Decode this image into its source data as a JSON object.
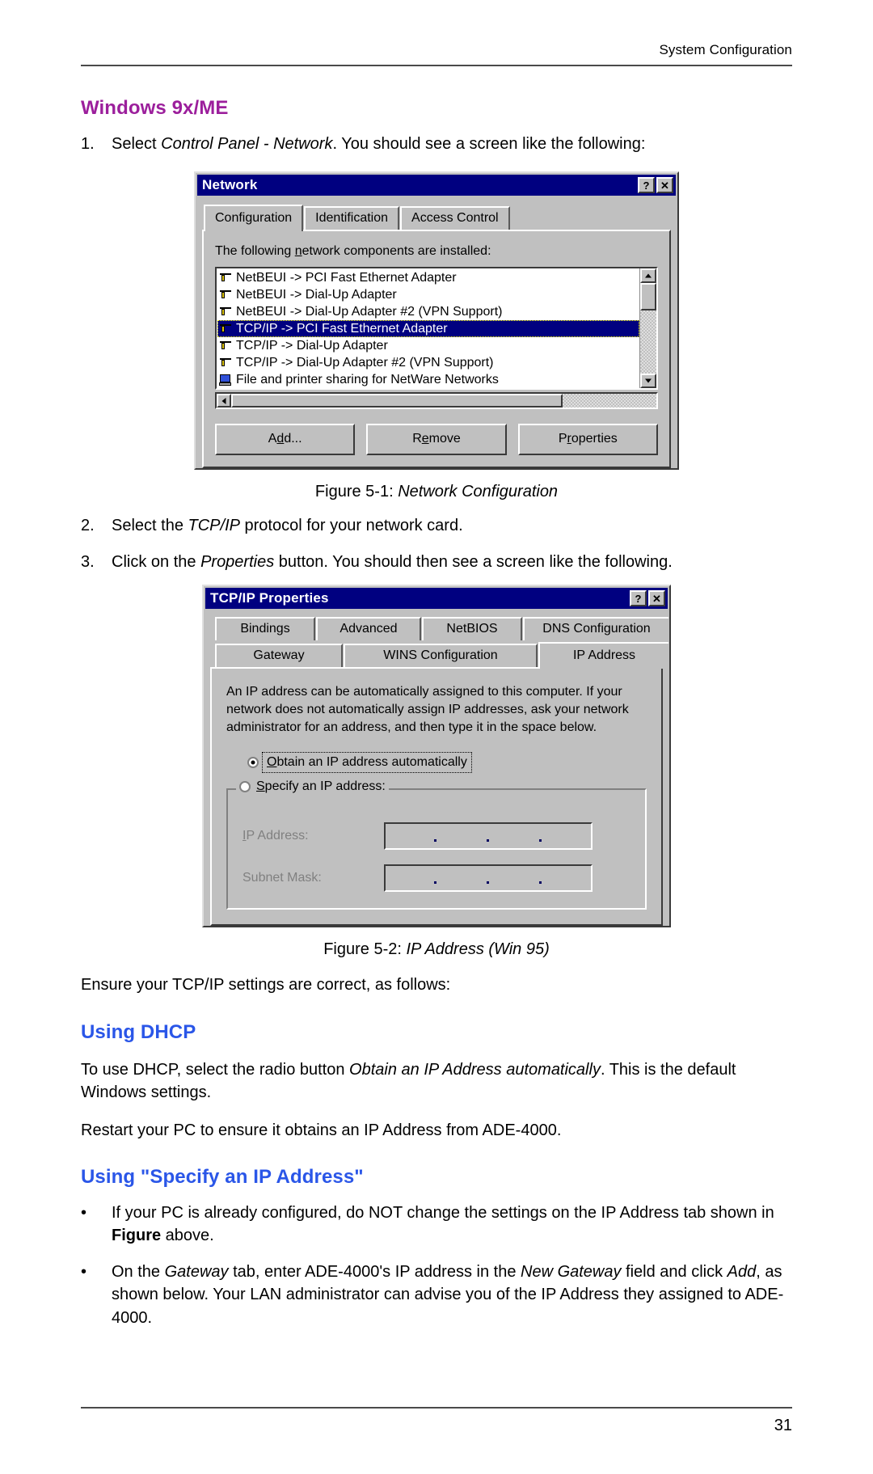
{
  "header": {
    "running_head": "System Configuration"
  },
  "sections": {
    "windows_heading": "Windows 9x/ME",
    "step1_num": "1.",
    "step1_pre": "Select ",
    "step1_italic": "Control Panel - Network",
    "step1_post": ". You should see a screen like the following:",
    "step2_num": "2.",
    "step2_pre": "Select the ",
    "step2_italic": "TCP/IP",
    "step2_post": " protocol for your network card.",
    "step3_num": "3.",
    "step3_pre": "Click on the ",
    "step3_italic": "Properties",
    "step3_post": " button. You should then see a screen like the following.",
    "ensure_line": "Ensure your TCP/IP settings are correct, as follows:",
    "dhcp_heading": "Using DHCP",
    "dhcp_p1_pre": "To use DHCP, select the radio button ",
    "dhcp_p1_italic": "Obtain an IP Address automatically",
    "dhcp_p1_post": ". This is the default Windows settings.",
    "dhcp_p2": "Restart your PC to ensure it obtains an IP Address from ADE-4000.",
    "specify_heading": "Using \"Specify an IP Address\"",
    "bullet_char": "•",
    "bullet1_a": "If your PC is already configured, do NOT change the settings on the IP Address tab shown in ",
    "bullet1_bold": "Figure",
    "bullet1_b": "  above.",
    "bullet2_a": "On the ",
    "bullet2_it1": "Gateway",
    "bullet2_b": " tab, enter ADE-4000's IP address in the ",
    "bullet2_it2": "New Gateway",
    "bullet2_c": " field and click ",
    "bullet2_it3": "Add",
    "bullet2_d": ", as shown below. Your LAN administrator can advise you of the IP Address they assigned to ADE-4000."
  },
  "figure1": {
    "caption_label": "Figure 5-1: ",
    "caption_italic": "Network Configuration",
    "title": "Network",
    "help_btn": "?",
    "close_btn": "✕",
    "tabs": [
      {
        "label": "Configuration",
        "active": true
      },
      {
        "label": "Identification",
        "active": false
      },
      {
        "label": "Access Control",
        "active": false
      }
    ],
    "list_label_pre": "The following ",
    "list_label_underline": "n",
    "list_label_post": "etwork components are installed:",
    "list_items": [
      {
        "text": "NetBEUI -> PCI Fast Ethernet Adapter",
        "icon": "protocol-icon",
        "selected": false
      },
      {
        "text": "NetBEUI -> Dial-Up Adapter",
        "icon": "protocol-icon",
        "selected": false
      },
      {
        "text": "NetBEUI -> Dial-Up Adapter #2 (VPN Support)",
        "icon": "protocol-icon",
        "selected": false
      },
      {
        "text": "TCP/IP -> PCI Fast Ethernet Adapter",
        "icon": "protocol-icon",
        "selected": true
      },
      {
        "text": "TCP/IP -> Dial-Up Adapter",
        "icon": "protocol-icon",
        "selected": false
      },
      {
        "text": "TCP/IP -> Dial-Up Adapter #2 (VPN Support)",
        "icon": "protocol-icon",
        "selected": false
      },
      {
        "text": "File and printer sharing for NetWare Networks",
        "icon": "service-icon",
        "selected": false
      }
    ],
    "buttons": [
      {
        "pre": "A",
        "accel": "d",
        "post": "d..."
      },
      {
        "pre": "R",
        "accel": "e",
        "post": "move"
      },
      {
        "pre": "P",
        "accel": "r",
        "post": "operties"
      }
    ]
  },
  "figure2": {
    "caption_label": "Figure 5-2: ",
    "caption_italic": "IP Address (Win 95)",
    "title": "TCP/IP Properties",
    "help_btn": "?",
    "close_btn": "✕",
    "tabs_row1": [
      {
        "label": "Bindings",
        "active": false
      },
      {
        "label": "Advanced",
        "active": false
      },
      {
        "label": "NetBIOS",
        "active": false
      },
      {
        "label": "DNS Configuration",
        "active": false
      }
    ],
    "tabs_row2": [
      {
        "label": "Gateway",
        "active": false
      },
      {
        "label": "WINS Configuration",
        "active": false
      },
      {
        "label": "IP Address",
        "active": true
      }
    ],
    "description": "An IP address can be automatically assigned to this computer.  If your network does not automatically assign IP addresses, ask your network administrator for an address, and then type it in the space below.",
    "radio_obtain_pre": "O",
    "radio_obtain_rest": "btain an IP address automatically",
    "radio_obtain_checked": true,
    "radio_specify_pre": "S",
    "radio_specify_rest": "pecify an IP address:",
    "radio_specify_checked": false,
    "field_ip_label_pre": "I",
    "field_ip_label_rest": "P Address:",
    "field_ip_value": "",
    "field_mask_label_pre": "Su",
    "field_mask_label_rest": "bnet Mask:",
    "field_mask_value": ""
  },
  "footer": {
    "page_number": "31"
  },
  "colors": {
    "heading_purple": "#9c1f9c",
    "heading_blue": "#2a56e8",
    "titlebar_blue": "#000080",
    "dialog_gray": "#c0c0c0"
  }
}
